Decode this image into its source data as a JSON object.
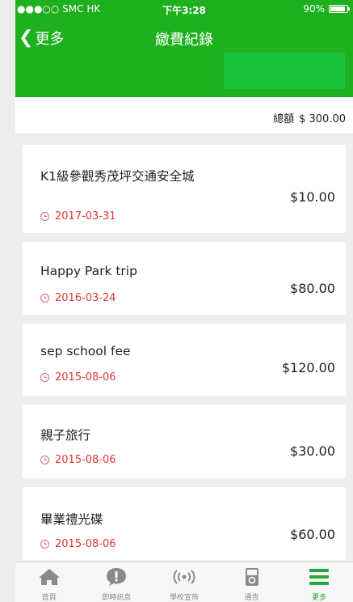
{
  "status_bar": {
    "carrier": "●●●○○ SMC HK",
    "time": "下午3:28",
    "battery_text": "90%",
    "battery_level": 0.9
  },
  "nav": {
    "back_label": "更多",
    "title": "繳費紀錄"
  },
  "summary": {
    "total_label": "總額",
    "total_value": "$ 300.00"
  },
  "records": [
    {
      "title": "K1級參觀秀茂坪交通安全城",
      "date": "2017-03-31",
      "amount": "$10.00"
    },
    {
      "title": "Happy Park trip",
      "date": "2016-03-24",
      "amount": "$80.00"
    },
    {
      "title": "sep school fee",
      "date": "2015-08-06",
      "amount": "$120.00"
    },
    {
      "title": "親子旅行",
      "date": "2015-08-06",
      "amount": "$30.00"
    },
    {
      "title": "畢業禮光碟",
      "date": "2015-08-06",
      "amount": "$60.00"
    }
  ],
  "tabs": [
    {
      "label": "首頁",
      "icon": "home-icon"
    },
    {
      "label": "即時訊息",
      "icon": "message-icon"
    },
    {
      "label": "學校宣佈",
      "icon": "broadcast-icon"
    },
    {
      "label": "通告",
      "icon": "notice-icon"
    },
    {
      "label": "更多",
      "icon": "menu-icon",
      "active": true
    }
  ],
  "colors": {
    "brand_green": "#1fb020",
    "date_red": "#e03535",
    "active_tab": "#20a83a"
  }
}
